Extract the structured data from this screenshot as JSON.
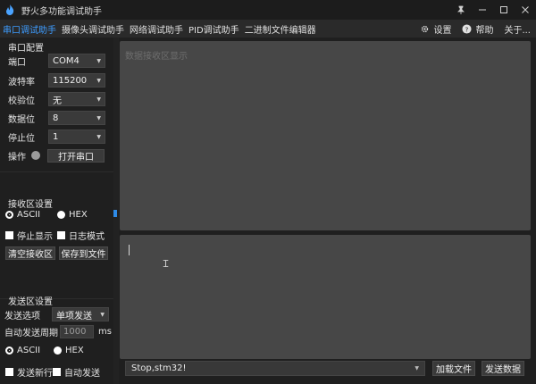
{
  "window": {
    "title": "野火多功能调试助手"
  },
  "menu": {
    "tabs": [
      "串口调试助手",
      "摄像头调试助手",
      "网络调试助手",
      "PID调试助手",
      "二进制文件编辑器"
    ],
    "settings": "设置",
    "help": "帮助",
    "about": "关于..."
  },
  "serial_config": {
    "title": "串口配置",
    "port": {
      "label": "端口",
      "value": "COM4"
    },
    "baud": {
      "label": "波特率",
      "value": "115200"
    },
    "parity": {
      "label": "校验位",
      "value": "无"
    },
    "databits": {
      "label": "数据位",
      "value": "8"
    },
    "stopbits": {
      "label": "停止位",
      "value": "1"
    },
    "operation": {
      "label": "操作",
      "button": "打开串口"
    }
  },
  "recv_settings": {
    "title": "接收区设置",
    "ascii": "ASCII",
    "hex": "HEX",
    "selected": "ASCII",
    "stop_display": "停止显示",
    "log_mode": "日志模式",
    "clear_button": "清空接收区",
    "save_button": "保存到文件"
  },
  "send_settings": {
    "title": "发送区设置",
    "send_option_label": "发送选项",
    "send_option_value": "单项发送",
    "auto_period_label": "自动发送周期",
    "auto_period_value": "1000",
    "auto_period_unit": "ms",
    "ascii": "ASCII",
    "hex": "HEX",
    "send_newline": "发送新行",
    "auto_send": "自动发送"
  },
  "receive_area": {
    "placeholder": "数据接收区显示"
  },
  "send_bar": {
    "history_value": "Stop,stm32!",
    "load_file_button": "加载文件",
    "send_button": "发送数据"
  },
  "colors": {
    "accent": "#3d9cff",
    "panel": "#474747",
    "background": "#1f1f1f"
  }
}
